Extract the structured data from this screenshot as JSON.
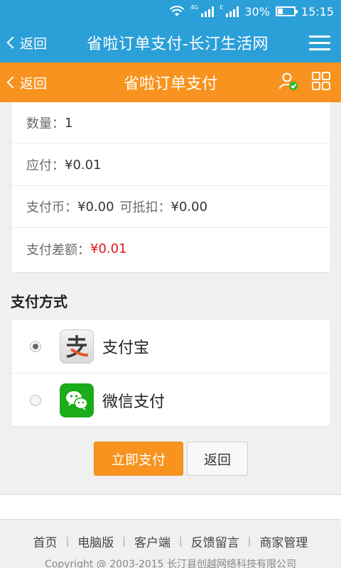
{
  "status": {
    "net_label": "4G",
    "net_label_2": "E",
    "battery": "30%",
    "time": "15:15"
  },
  "appbar": {
    "back_label": "返回",
    "title": "省啦订单支付-长汀生活网"
  },
  "pagebar": {
    "back_label": "返回",
    "title": "省啦订单支付"
  },
  "order": {
    "rows": [
      {
        "label": "数量：",
        "value": "1"
      },
      {
        "label": "应付：",
        "value": "¥0.01"
      },
      {
        "label": "支付币：",
        "value": "¥0.00",
        "label2": "可抵扣：",
        "value2": "¥0.00"
      },
      {
        "label": "支付差额：",
        "value": "¥0.01"
      }
    ]
  },
  "payment": {
    "section_title": "支付方式",
    "options": [
      {
        "label": "支付宝",
        "selected": true
      },
      {
        "label": "微信支付",
        "selected": false
      }
    ]
  },
  "actions": {
    "pay_label": "立即支付",
    "back_label": "返回"
  },
  "footer": {
    "links": [
      "首页",
      "电脑版",
      "客户端",
      "反馈留言",
      "商家管理"
    ],
    "separator": "|",
    "copyright": "Copyright @ 2003-2015 长汀县创越网络科技有限公司"
  },
  "colors": {
    "appbar": "#2b9fd8",
    "pagebar": "#f7931e",
    "price_red": "#e4141e",
    "wechat_green": "#1aac19"
  }
}
